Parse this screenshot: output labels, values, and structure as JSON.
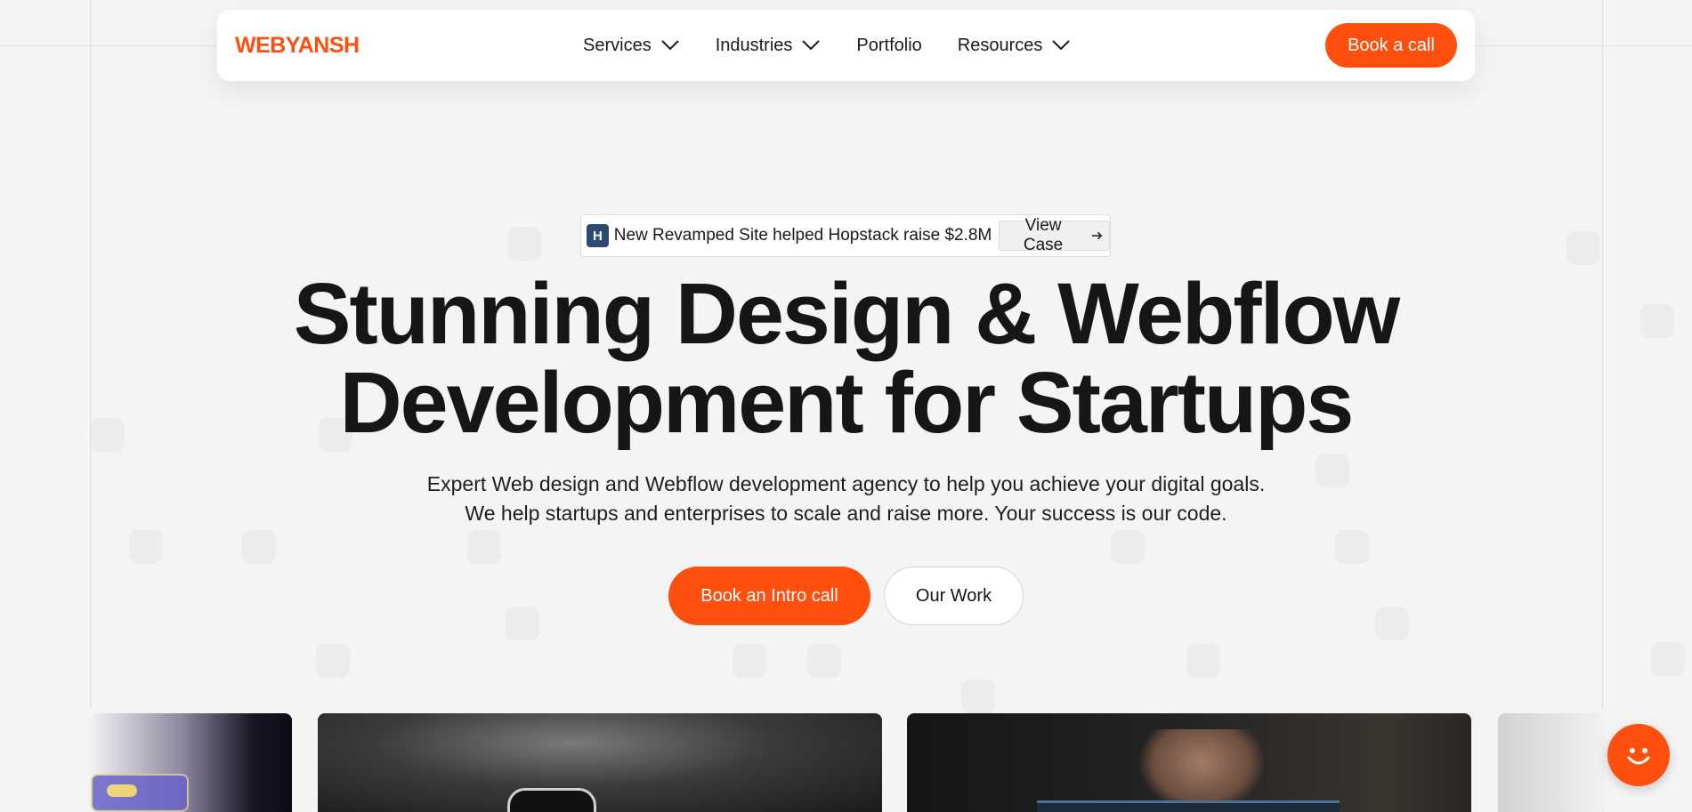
{
  "brand": {
    "logo_text": "WEBYANSH",
    "accent_color": "#ff4f0f"
  },
  "nav": {
    "items": [
      {
        "label": "Services",
        "has_dropdown": true
      },
      {
        "label": "Industries",
        "has_dropdown": true
      },
      {
        "label": "Portfolio",
        "has_dropdown": false
      },
      {
        "label": "Resources",
        "has_dropdown": true
      }
    ],
    "cta_label": "Book a call"
  },
  "announcement": {
    "logo_letter": "H",
    "text": "New Revamped Site helped Hopstack raise $2.8M",
    "link_label": "View Case",
    "link_icon": "arrow-right-icon"
  },
  "hero": {
    "title_line1": "Stunning Design & Webflow",
    "title_line2": "Development for Startups",
    "subtitle_line1": "Expert Web design and Webflow development agency to help you achieve your digital goals.",
    "subtitle_line2": "We help startups and enterprises to scale and raise more. Your success is our code.",
    "primary_cta": "Book an Intro call",
    "secondary_cta": "Our Work"
  },
  "showcase": {
    "cards": [
      "ui-mockup-card",
      "device-on-rock-card",
      "hand-laptop-card",
      "partial-card"
    ]
  },
  "chat": {
    "icon": "smiley-chat-icon"
  }
}
